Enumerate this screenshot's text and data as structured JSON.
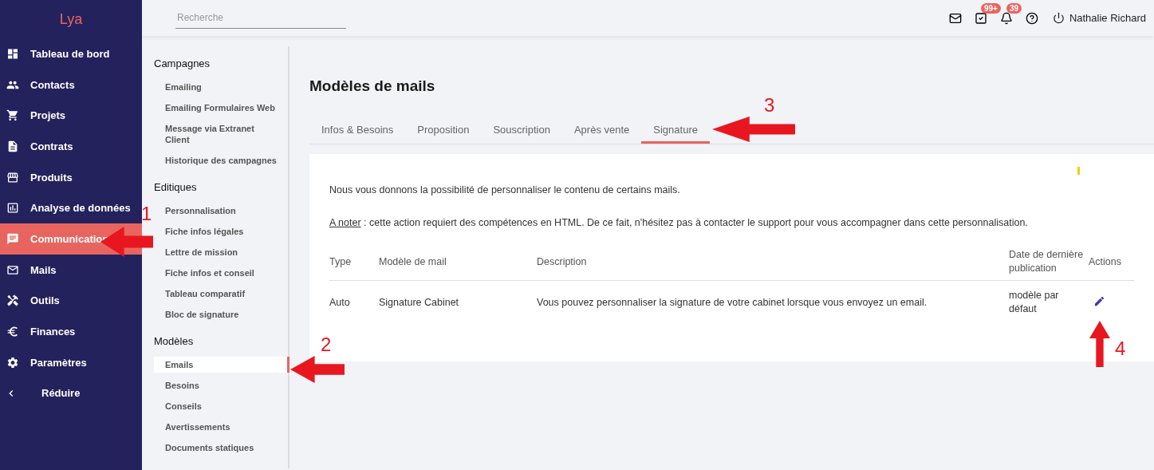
{
  "logo": "Lya",
  "sidebar": {
    "items": [
      {
        "label": "Tableau de bord",
        "selected": false
      },
      {
        "label": "Contacts",
        "selected": false
      },
      {
        "label": "Projets",
        "selected": false
      },
      {
        "label": "Contrats",
        "selected": false
      },
      {
        "label": "Produits",
        "selected": false
      },
      {
        "label": "Analyse de données",
        "selected": false
      },
      {
        "label": "Communication",
        "selected": true
      },
      {
        "label": "Mails",
        "selected": false
      },
      {
        "label": "Outils",
        "selected": false
      },
      {
        "label": "Finances",
        "selected": false
      },
      {
        "label": "Paramètres",
        "selected": false
      }
    ],
    "collapse": "Réduire"
  },
  "topbar": {
    "search": {
      "placeholder": "Recherche"
    },
    "badges": [
      "99+",
      "39"
    ],
    "user": "Nathalie Richard"
  },
  "subnav": [
    {
      "heading": "Campagnes",
      "items": [
        {
          "label": "Emailing",
          "selected": false
        },
        {
          "label": "Emailing Formulaires Web",
          "selected": false
        },
        {
          "label": "Message via Extranet Client",
          "selected": false
        },
        {
          "label": "Historique des campagnes",
          "selected": false
        }
      ]
    },
    {
      "heading": "Editiques",
      "items": [
        {
          "label": "Personnalisation",
          "selected": false
        },
        {
          "label": "Fiche infos légales",
          "selected": false
        },
        {
          "label": "Lettre de mission",
          "selected": false
        },
        {
          "label": "Fiche infos et conseil",
          "selected": false
        },
        {
          "label": "Tableau comparatif",
          "selected": false
        },
        {
          "label": "Bloc de signature",
          "selected": false
        }
      ]
    },
    {
      "heading": "Modèles",
      "items": [
        {
          "label": "Emails",
          "selected": true
        },
        {
          "label": "Besoins",
          "selected": false
        },
        {
          "label": "Conseils",
          "selected": false
        },
        {
          "label": "Avertissements",
          "selected": false
        },
        {
          "label": "Documents statiques",
          "selected": false
        }
      ]
    }
  ],
  "page": {
    "title": "Modèles de mails",
    "tabs": [
      {
        "label": "Infos & Besoins",
        "selected": false
      },
      {
        "label": "Proposition",
        "selected": false
      },
      {
        "label": "Souscription",
        "selected": false
      },
      {
        "label": "Après vente",
        "selected": false
      },
      {
        "label": "Signature",
        "selected": true
      }
    ],
    "intro": "Nous vous donnons la possibilité de personnaliser le contenu de certains mails.",
    "note_label": "A noter",
    "note": " : cette action requiert des compétences en HTML. De ce fait, n'hésitez pas à contacter le support pour vous accompagner dans cette personnalisation.",
    "table": {
      "columns": [
        "Type",
        "Modèle de mail",
        "Description",
        "Date de dernière publication",
        "Actions"
      ],
      "rows": [
        {
          "type": "Auto",
          "model": "Signature Cabinet",
          "description": "Vous pouvez personnaliser la signature de votre cabinet lorsque vous envoyez un email.",
          "date": "modèle par défaut"
        }
      ]
    }
  },
  "annotations": [
    "1",
    "2",
    "3",
    "4"
  ]
}
